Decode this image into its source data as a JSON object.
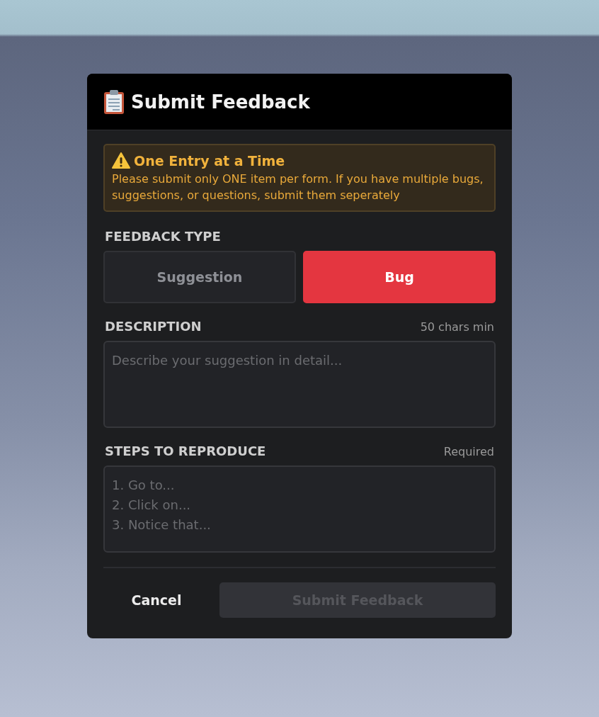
{
  "dialog": {
    "title": "Submit Feedback",
    "notice": {
      "title": "One Entry at a Time",
      "text": "Please submit only ONE item per form. If you have multiple bugs, suggestions, or questions, submit them seperately"
    },
    "feedback_type": {
      "label": "FEEDBACK TYPE",
      "options": [
        {
          "label": "Suggestion",
          "selected": false
        },
        {
          "label": "Bug",
          "selected": true
        }
      ]
    },
    "fields": [
      {
        "label": "DESCRIPTION",
        "hint": "50 chars min",
        "placeholder": "Describe your suggestion in detail..."
      },
      {
        "label": "STEPS TO REPRODUCE",
        "hint": "Required",
        "placeholder": "1. Go to...\n2. Click on...\n3. Notice that..."
      }
    ],
    "cancel": "Cancel",
    "submit": {
      "label": "Submit Feedback",
      "disabled": true
    }
  }
}
